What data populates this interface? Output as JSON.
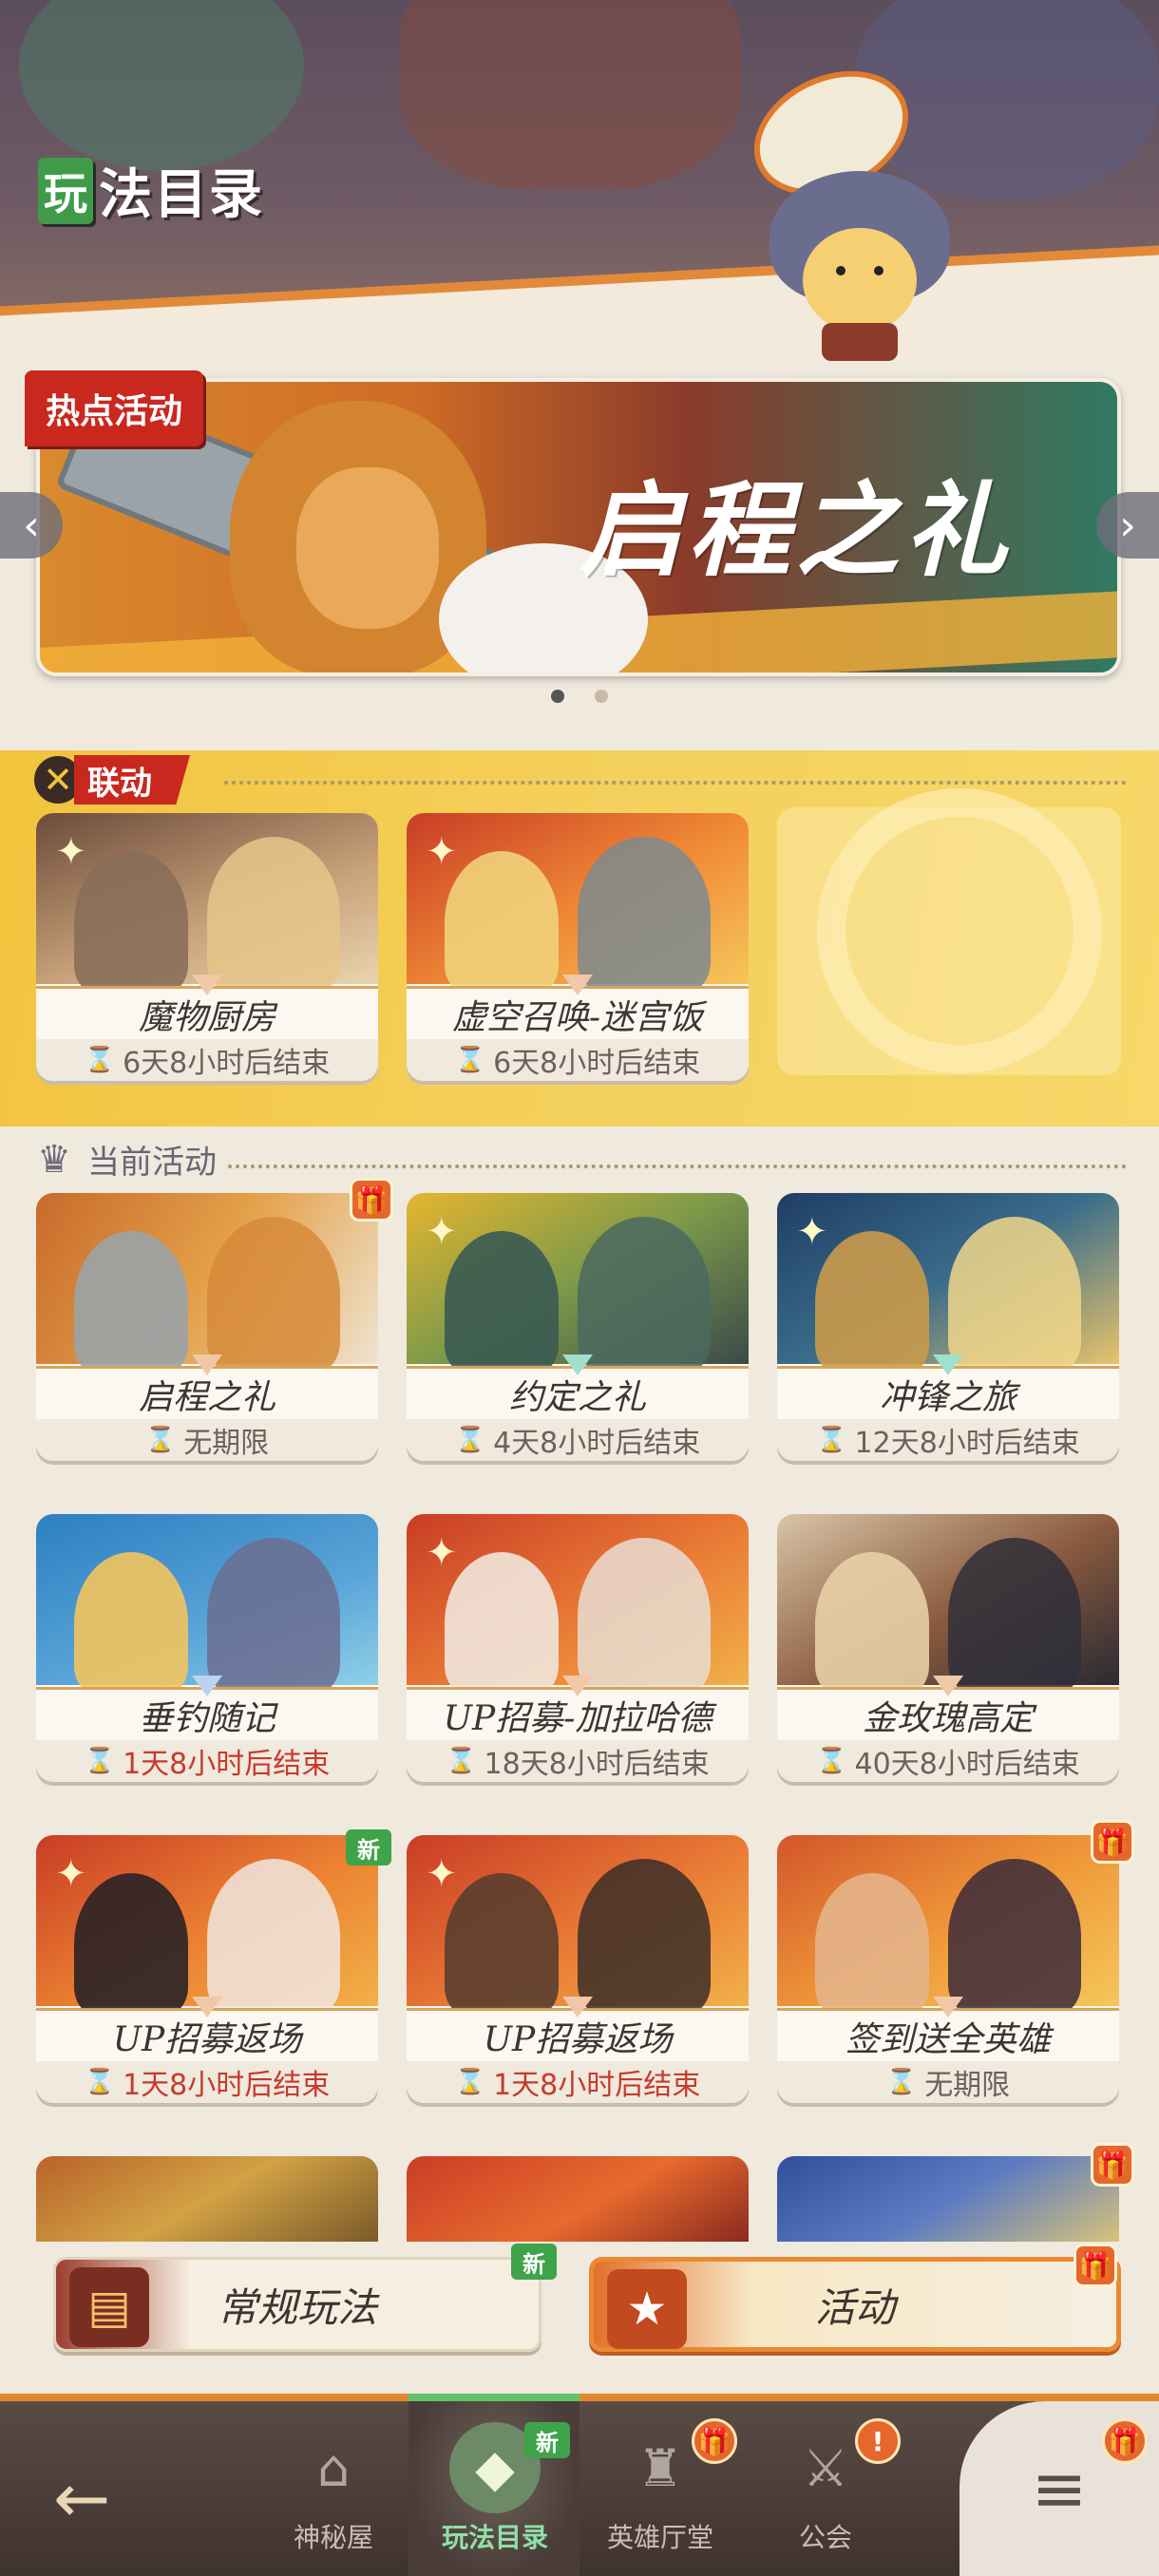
{
  "header": {
    "title_icon_char": "玩",
    "title": "法目录"
  },
  "banner": {
    "hot_tag": "热点活动",
    "title": "启程之礼",
    "prev_arrow": "‹",
    "next_arrow": "›",
    "page_count": 2,
    "active_page": 1
  },
  "collab": {
    "label": "联动",
    "cards": [
      {
        "name": "魔物厨房",
        "timer": "6天8小时后结束",
        "urgent": false
      },
      {
        "name": "虚空召唤-迷宫饭",
        "timer": "6天8小时后结束",
        "urgent": false
      }
    ]
  },
  "current": {
    "label": "当前活动",
    "cards": [
      {
        "name": "启程之礼",
        "timer": "无期限",
        "urgent": false,
        "badge": "gift"
      },
      {
        "name": "约定之礼",
        "timer": "4天8小时后结束",
        "urgent": false,
        "badge": ""
      },
      {
        "name": "冲锋之旅",
        "timer": "12天8小时后结束",
        "urgent": false,
        "badge": ""
      },
      {
        "name": "垂钓随记",
        "timer": "1天8小时后结束",
        "urgent": true,
        "badge": ""
      },
      {
        "name": "UP招募-加拉哈德",
        "timer": "18天8小时后结束",
        "urgent": false,
        "badge": ""
      },
      {
        "name": "金玫瑰高定",
        "timer": "40天8小时后结束",
        "urgent": false,
        "badge": ""
      },
      {
        "name": "UP招募返场",
        "timer": "1天8小时后结束",
        "urgent": true,
        "badge": "new"
      },
      {
        "name": "UP招募返场",
        "timer": "1天8小时后结束",
        "urgent": true,
        "badge": ""
      },
      {
        "name": "签到送全英雄",
        "timer": "无期限",
        "urgent": false,
        "badge": "gift"
      }
    ]
  },
  "badges": {
    "new": "新",
    "gift": "🎁",
    "alert": "!"
  },
  "category_tabs": {
    "regular": "常规玩法",
    "activity": "活动"
  },
  "bottom_nav": {
    "back": "←",
    "items": [
      {
        "label": "神秘屋",
        "icon": "mystery-house-icon"
      },
      {
        "label": "玩法目录",
        "icon": "play-catalog-icon",
        "active": true
      },
      {
        "label": "英雄厅堂",
        "icon": "hero-hall-icon"
      },
      {
        "label": "公会",
        "icon": "guild-icon"
      }
    ],
    "menu": "≡"
  },
  "colors": {
    "accent": "#e2882f",
    "urgent": "#c73a2c",
    "new_badge": "#3fa34a",
    "hot_tag": "#c8281e"
  }
}
